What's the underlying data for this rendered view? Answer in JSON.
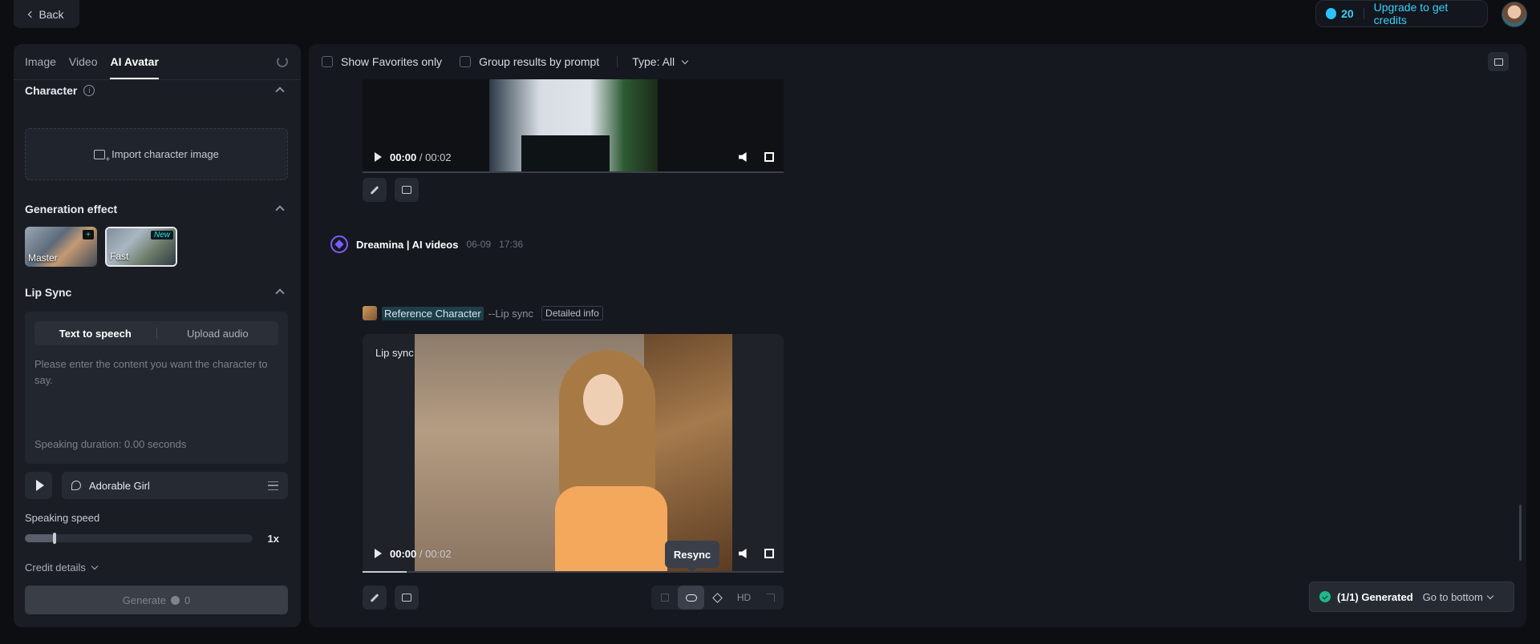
{
  "header": {
    "back_label": "Back",
    "credits": "20",
    "upgrade_label": "Upgrade to get credits"
  },
  "left": {
    "tabs": [
      {
        "label": "Image"
      },
      {
        "label": "Video"
      },
      {
        "label": "AI Avatar"
      }
    ],
    "character": {
      "title": "Character",
      "info_glyph": "i",
      "import_label": "Import character image"
    },
    "generation_effect": {
      "title": "Generation effect",
      "options": [
        {
          "label": "Master",
          "badge": "+"
        },
        {
          "label": "Fast",
          "badge": "New"
        }
      ]
    },
    "lip_sync": {
      "title": "Lip Sync",
      "modes": [
        "Text to speech",
        "Upload audio"
      ],
      "placeholder": "Please enter the content you want the character to say.",
      "duration": "Speaking duration: 0.00 seconds",
      "voice": "Adorable Girl"
    },
    "speed": {
      "label": "Speaking speed",
      "value_label": "1x",
      "level": 0.13
    },
    "credit_details": "Credit details",
    "generate": {
      "label": "Generate",
      "cost": "0"
    }
  },
  "right": {
    "filters": {
      "favorites": "Show Favorites only",
      "group": "Group results by prompt",
      "type": "Type: All"
    },
    "video1": {
      "time_current": "00:00",
      "time_sep": " / ",
      "time_total": "00:02"
    },
    "generation": {
      "author": "Dreamina | AI videos",
      "date": "06-09",
      "time": "17:36",
      "reference": "Reference Character",
      "mode_tag": "--Lip sync",
      "detail_label": "Detailed info"
    },
    "video2": {
      "overlay_label": "Lip sync",
      "time_current": "00:00",
      "time_sep": " / ",
      "time_total": "00:02"
    },
    "tools": {
      "hd_label": "HD",
      "tooltip": "Resync"
    },
    "status": {
      "count": "(1/1) Generated",
      "goto": "Go to bottom"
    }
  }
}
